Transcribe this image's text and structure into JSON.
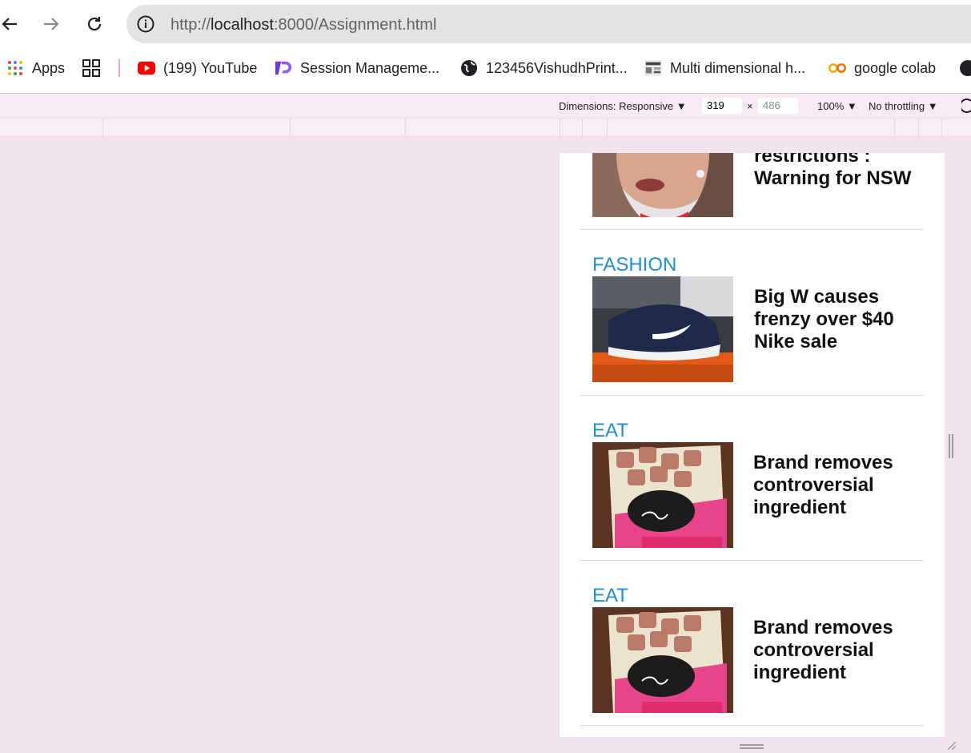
{
  "browser": {
    "url_prefix": "http://",
    "url_host": "localhost",
    "url_rest": ":8000/Assignment.html"
  },
  "bookmarks": [
    {
      "label": "Apps",
      "icon": "apps-grid-icon"
    },
    {
      "label": "",
      "icon": "tab-groups-icon"
    },
    {
      "label": "(199) YouTube",
      "icon": "youtube-icon"
    },
    {
      "label": "Session Manageme...",
      "icon": "session-manager-icon"
    },
    {
      "label": "123456VishudhPrint...",
      "icon": "globe-icon"
    },
    {
      "label": "Multi dimensional h...",
      "icon": "thumbnail-icon"
    },
    {
      "label": "google colab",
      "icon": "colab-icon"
    }
  ],
  "devtools": {
    "dimensions_label": "Dimensions: Responsive",
    "width": "319",
    "times": "×",
    "height": "486",
    "zoom": "100%",
    "throttle": "No throttling"
  },
  "articles": [
    {
      "category": "",
      "headline_lines": [
        "restrictions :",
        "Warning for NSW"
      ],
      "image": "woman-portrait"
    },
    {
      "category": "FASHION",
      "headline_lines": [
        "Big W causes",
        "frenzy over $40",
        "Nike sale"
      ],
      "image": "nike-shoe"
    },
    {
      "category": "EAT",
      "headline_lines": [
        "Brand removes",
        "controversial",
        "ingredient"
      ],
      "image": "raspberry-chocolate"
    },
    {
      "category": "EAT",
      "headline_lines": [
        "Brand removes",
        "controversial",
        "ingredient"
      ],
      "image": "raspberry-chocolate"
    }
  ],
  "colors": {
    "category": "#1e8fd5",
    "chrome_bg": "#f2e4ee"
  }
}
